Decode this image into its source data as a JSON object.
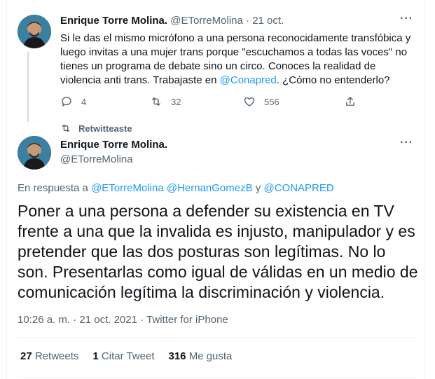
{
  "tweet1": {
    "author_name": "Enrique Torre Molina.",
    "author_handle": "@ETorreMolina",
    "separator": "·",
    "date": "21 oct.",
    "text_part1": "Si le das el mismo micrófono a una persona reconocidamente transfóbica y luego invitas a una mujer trans porque \"escuchamos a todas las voces\" no tienes un programa de debate sino un circo. Conoces la realidad de violencia anti trans. Trabajaste en ",
    "text_mention": "@Conapred",
    "text_part2": ". ¿Cómo no entenderlo?",
    "replies": "4",
    "retweets": "32",
    "likes": "556"
  },
  "retweet_banner": "Retwitteaste",
  "tweet2": {
    "author_name": "Enrique Torre Molina.",
    "author_handle": "@ETorreMolina",
    "reply_prefix": "En respuesta a",
    "reply_mention1": "@ETorreMolina",
    "reply_mention2": "@HernanGomezB",
    "reply_and": "y",
    "reply_mention3": "@CONAPRED",
    "text": "Poner a una persona a defender su existencia en TV frente a una que la invalida es injusto, manipulador y es pretender que las dos posturas son legítimas. No lo son. Presentarlas como igual de válidas en un medio de comunicación legítima la discriminación y violencia.",
    "time": "10:26 a. m.",
    "date": "21 oct. 2021",
    "separator": "·",
    "source": "Twitter for iPhone",
    "retweets_count": "27",
    "retweets_label": "Retweets",
    "quotes_count": "1",
    "quotes_label": "Citar Tweet",
    "likes_count": "316",
    "likes_label": "Me gusta"
  },
  "more_icon": "···",
  "colors": {
    "accent": "#1d9bf0",
    "muted": "#536471",
    "text": "#0f1419",
    "border": "#eff3f4"
  }
}
